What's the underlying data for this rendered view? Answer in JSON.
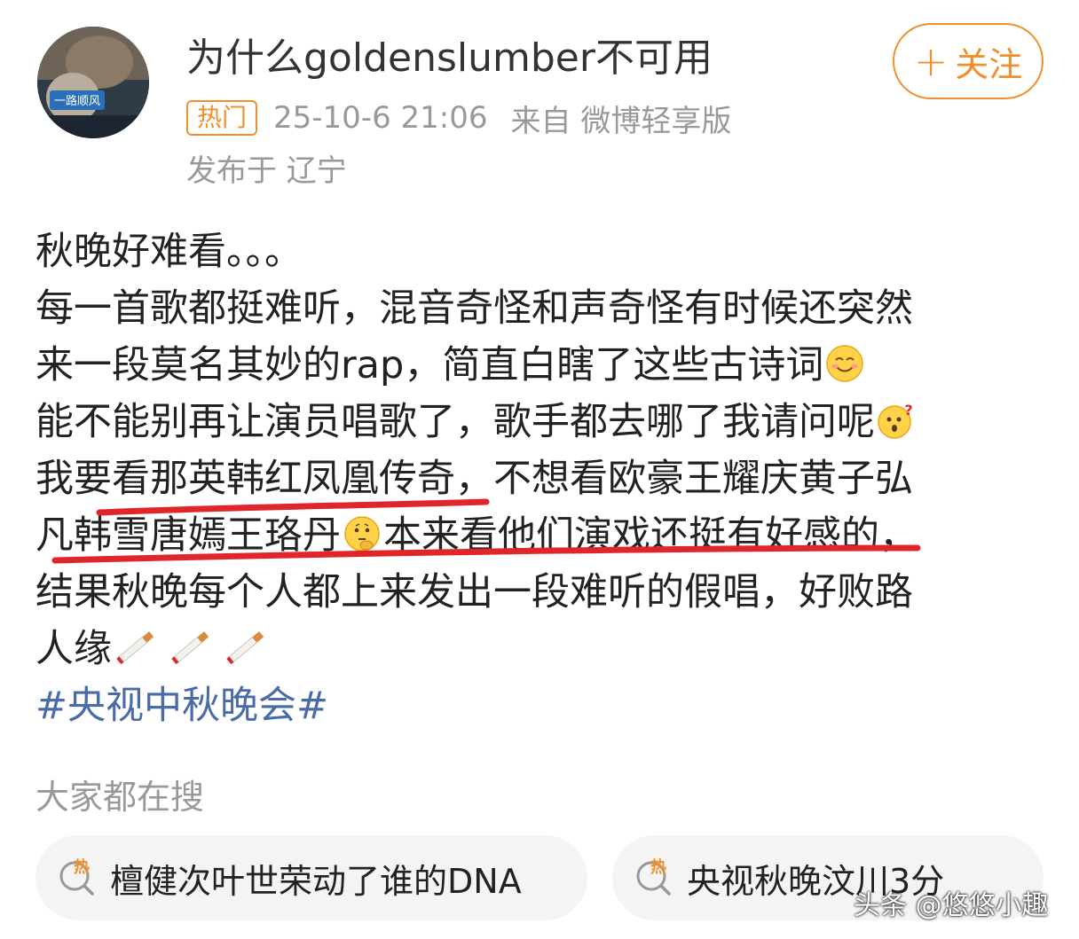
{
  "header": {
    "username": "为什么goldenslumber不可用",
    "follow_label": "关注",
    "follow_plus": "+",
    "hot_badge": "热门",
    "time": "25-10-6 21:06",
    "source": "来自 微博轻享版",
    "location": "发布于 辽宁",
    "avatar_text": "一路顺风"
  },
  "post": {
    "line1": "秋晚好难看。。。",
    "line2": "每一首歌都挺难听，混音奇怪和声奇怪有时候还突然",
    "line3": "来一段莫名其妙的rap，简直白瞎了这些古诗词",
    "line4": "能不能别再让演员唱歌了，歌手都去哪了我请问呢",
    "line5": "我要看那英韩红凤凰传奇，不想看欧豪王耀庆黄子弘",
    "line6a": "凡韩雪唐嫣王珞丹",
    "line6b": "本来看他们演戏还挺有好感的，",
    "line7": "结果秋晚每个人都上来发出一段难听的假唱，好败路",
    "line8": "人缘",
    "hashtag": "#央视中秋晚会#",
    "emoji_names": [
      "smile-emoji",
      "confused-emoji",
      "thinking-emoji",
      "cigarette-emoji"
    ]
  },
  "search": {
    "title": "大家都在搜",
    "items": [
      {
        "label": "檀健次叶世荣动了谁的DNA",
        "icon_label": "热"
      },
      {
        "label": "央视秋晚汶川3分",
        "icon_label": "热"
      }
    ]
  },
  "watermark": "头条 @悠悠小趣",
  "colors": {
    "accent": "#f08f2e",
    "hashtag": "#4a6aa8",
    "underline": "#e0262b",
    "muted": "#999999"
  }
}
